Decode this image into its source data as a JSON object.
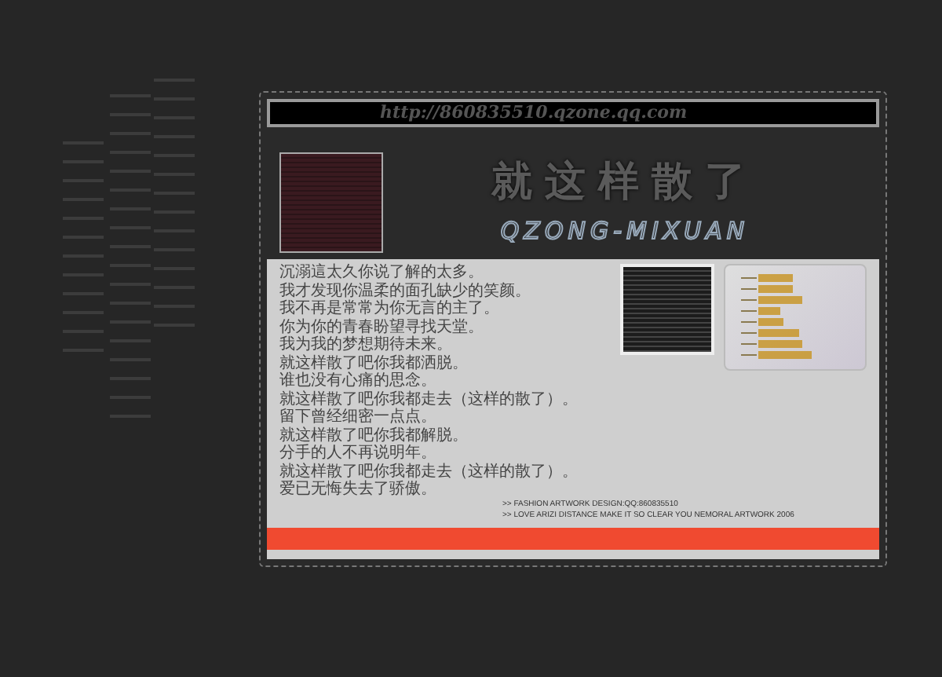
{
  "url_bar": {
    "text": "http://860835510.qzone.qq.com"
  },
  "header": {
    "title": "就这样散了",
    "subtitle": "QZONG-MIXUAN"
  },
  "poem": {
    "lines": [
      "沉溺這太久你说了解的太多。",
      "我才发现你温柔的面孔缺少的笑颜。",
      "我不再是常常为你无言的主了。",
      "你为你的青春盼望寻找天堂。",
      "我为我的梦想期待未来。",
      "就这样散了吧你我都洒脱。",
      "谁也没有心痛的思念。",
      "就这样散了吧你我都走去（这样的散了）。",
      "留下曾经细密一点点。",
      "就这样散了吧你我都解脱。",
      "分手的人不再说明年。",
      "就这样散了吧你我都走去（这样的散了）。",
      "爱已无悔失去了骄傲。"
    ]
  },
  "credits": [
    ">> FASHION ARTWORK DESIGN:QQ:860835510",
    ">> LOVE ARIZI DISTANCE MAKE IT SO CLEAR YOU NEMORAL ARTWORK 2006"
  ]
}
